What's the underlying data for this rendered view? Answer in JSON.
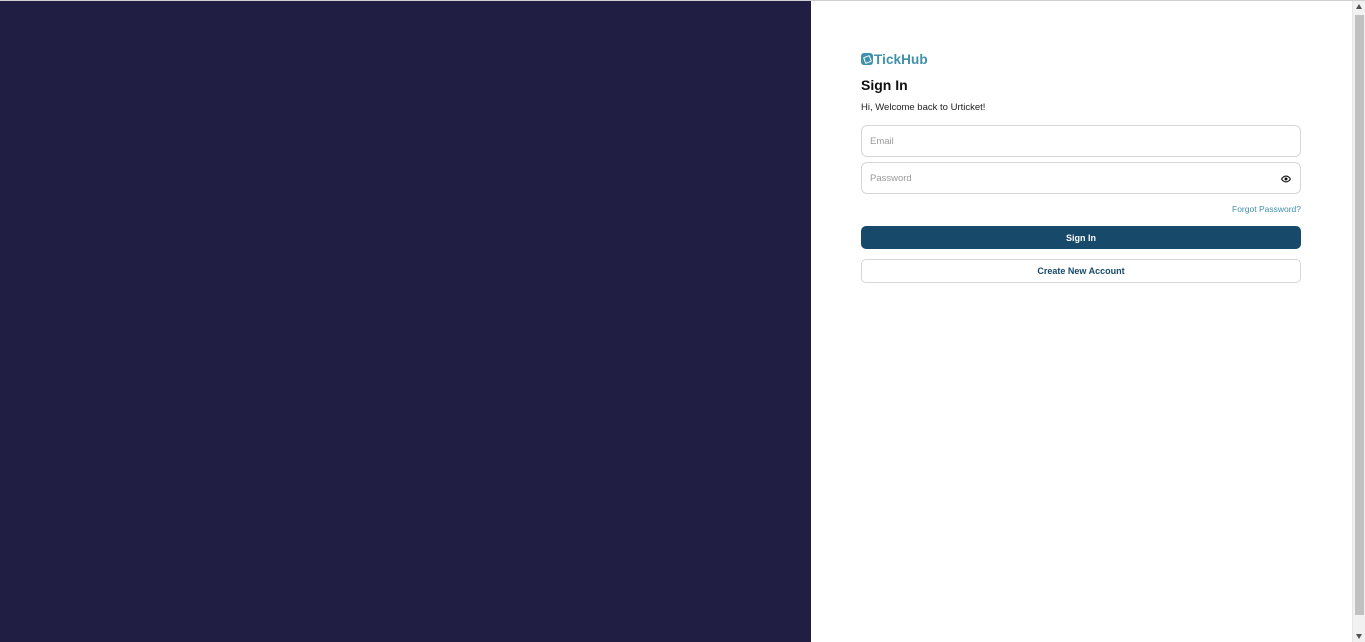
{
  "brand": {
    "name": "TickHub",
    "icon": "ticket-icon",
    "color": "#3f90aa"
  },
  "signin": {
    "title": "Sign In",
    "subtitle": "Hi, Welcome back to Urticket!",
    "email": {
      "value": "",
      "placeholder": "Email"
    },
    "password": {
      "value": "",
      "placeholder": "Password",
      "toggle_icon": "eye-icon"
    },
    "forgot_label": "Forgot Password?",
    "submit_label": "Sign In",
    "create_label": "Create New Account"
  },
  "colors": {
    "left_panel": "#201e42",
    "primary": "#17496a",
    "accent": "#3f90aa"
  }
}
